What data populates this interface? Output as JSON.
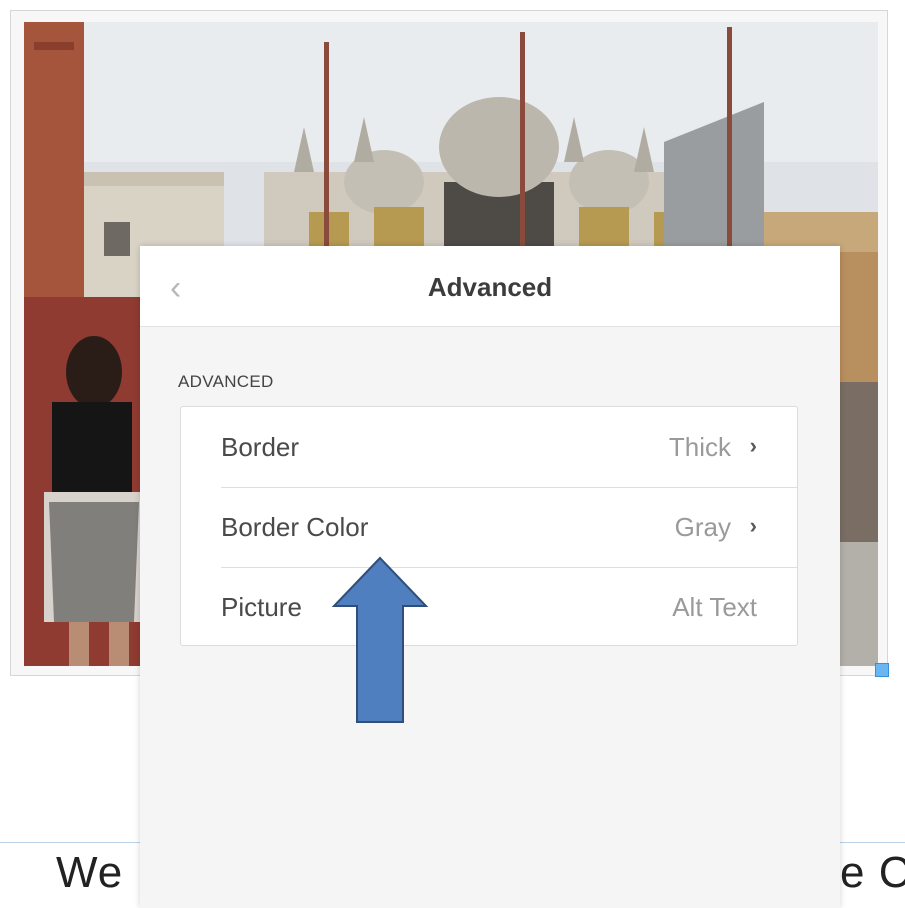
{
  "panel": {
    "title": "Advanced",
    "back_icon": "chevron-left-icon",
    "section_label": "ADVANCED",
    "rows": [
      {
        "label": "Border",
        "value": "Thick",
        "icon": "chevron-right-icon"
      },
      {
        "label": "Border Color",
        "value": "Gray",
        "icon": "chevron-right-icon"
      },
      {
        "label": "Picture",
        "value": "Alt Text"
      }
    ]
  },
  "document": {
    "text_left": "We",
    "text_right": "e C"
  },
  "annotation": {
    "arrow_color": "#4f7fbf",
    "arrow_outline": "#2f4f7a",
    "arrow_direction": "up"
  },
  "colors": {
    "selection_handle": "#6ab6f2",
    "panel_background": "#f5f5f5"
  }
}
